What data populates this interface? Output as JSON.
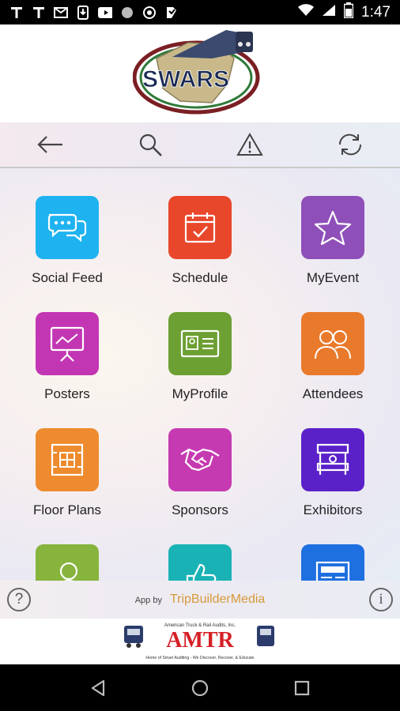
{
  "status_bar": {
    "time": "1:47",
    "left_icons": [
      "t-icon",
      "t-icon",
      "gmail-icon",
      "download-icon",
      "youtube-icon",
      "circle-icon",
      "shield-icon",
      "b-icon"
    ],
    "right_icons": [
      "wifi-icon",
      "signal-icon",
      "battery-icon"
    ]
  },
  "header": {
    "logo_text": "SWARS"
  },
  "toolbar": {
    "items": [
      "back-arrow-icon",
      "search-icon",
      "alert-icon",
      "refresh-icon"
    ]
  },
  "tiles": [
    {
      "label": "Social Feed",
      "color": "#1EB3F0",
      "icon": "chat-bubbles-icon"
    },
    {
      "label": "Schedule",
      "color": "#E8472B",
      "icon": "calendar-check-icon"
    },
    {
      "label": "MyEvent",
      "color": "#8F4FB9",
      "icon": "star-icon"
    },
    {
      "label": "Posters",
      "color": "#C236B3",
      "icon": "presentation-board-icon"
    },
    {
      "label": "MyProfile",
      "color": "#6CA033",
      "icon": "id-card-icon"
    },
    {
      "label": "Attendees",
      "color": "#E97A2C",
      "icon": "people-icon"
    },
    {
      "label": "Floor Plans",
      "color": "#EE8B2E",
      "icon": "floor-plan-icon"
    },
    {
      "label": "Sponsors",
      "color": "#C63AB1",
      "icon": "handshake-icon"
    },
    {
      "label": "Exhibitors",
      "color": "#5B21C9",
      "icon": "booth-icon"
    },
    {
      "label": "",
      "color": "#86B43C",
      "icon": "speaker-icon"
    },
    {
      "label": "",
      "color": "#1AB3B5",
      "icon": "thumbs-up-icon"
    },
    {
      "label": "",
      "color": "#1E6FE0",
      "icon": "news-icon"
    }
  ],
  "footer": {
    "app_by_prefix": "App by",
    "app_by_brand": "TripBuilderMedia",
    "help_glyph": "?",
    "info_glyph": "i"
  },
  "banner": {
    "company_small": "American Truck & Rail Audits, Inc.",
    "logo_text": "AMTR",
    "tagline": "Home of Smart Auditing - We Discover, Recover, & Educate"
  }
}
